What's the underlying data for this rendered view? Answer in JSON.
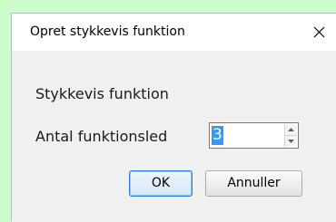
{
  "dialog": {
    "title": "Opret stykkevis funktion",
    "heading": "Stykkevis funktion",
    "field_label": "Antal funktionsled",
    "field_value": "3",
    "ok_label": "OK",
    "cancel_label": "Annuller"
  },
  "icons": {
    "close": "close-icon",
    "spin_up": "spin-up-arrow-icon",
    "spin_down": "spin-down-arrow-icon"
  },
  "colors": {
    "background": "#ccfbcc",
    "selection": "#3399ff",
    "default_button_border": "#2a7de1"
  }
}
